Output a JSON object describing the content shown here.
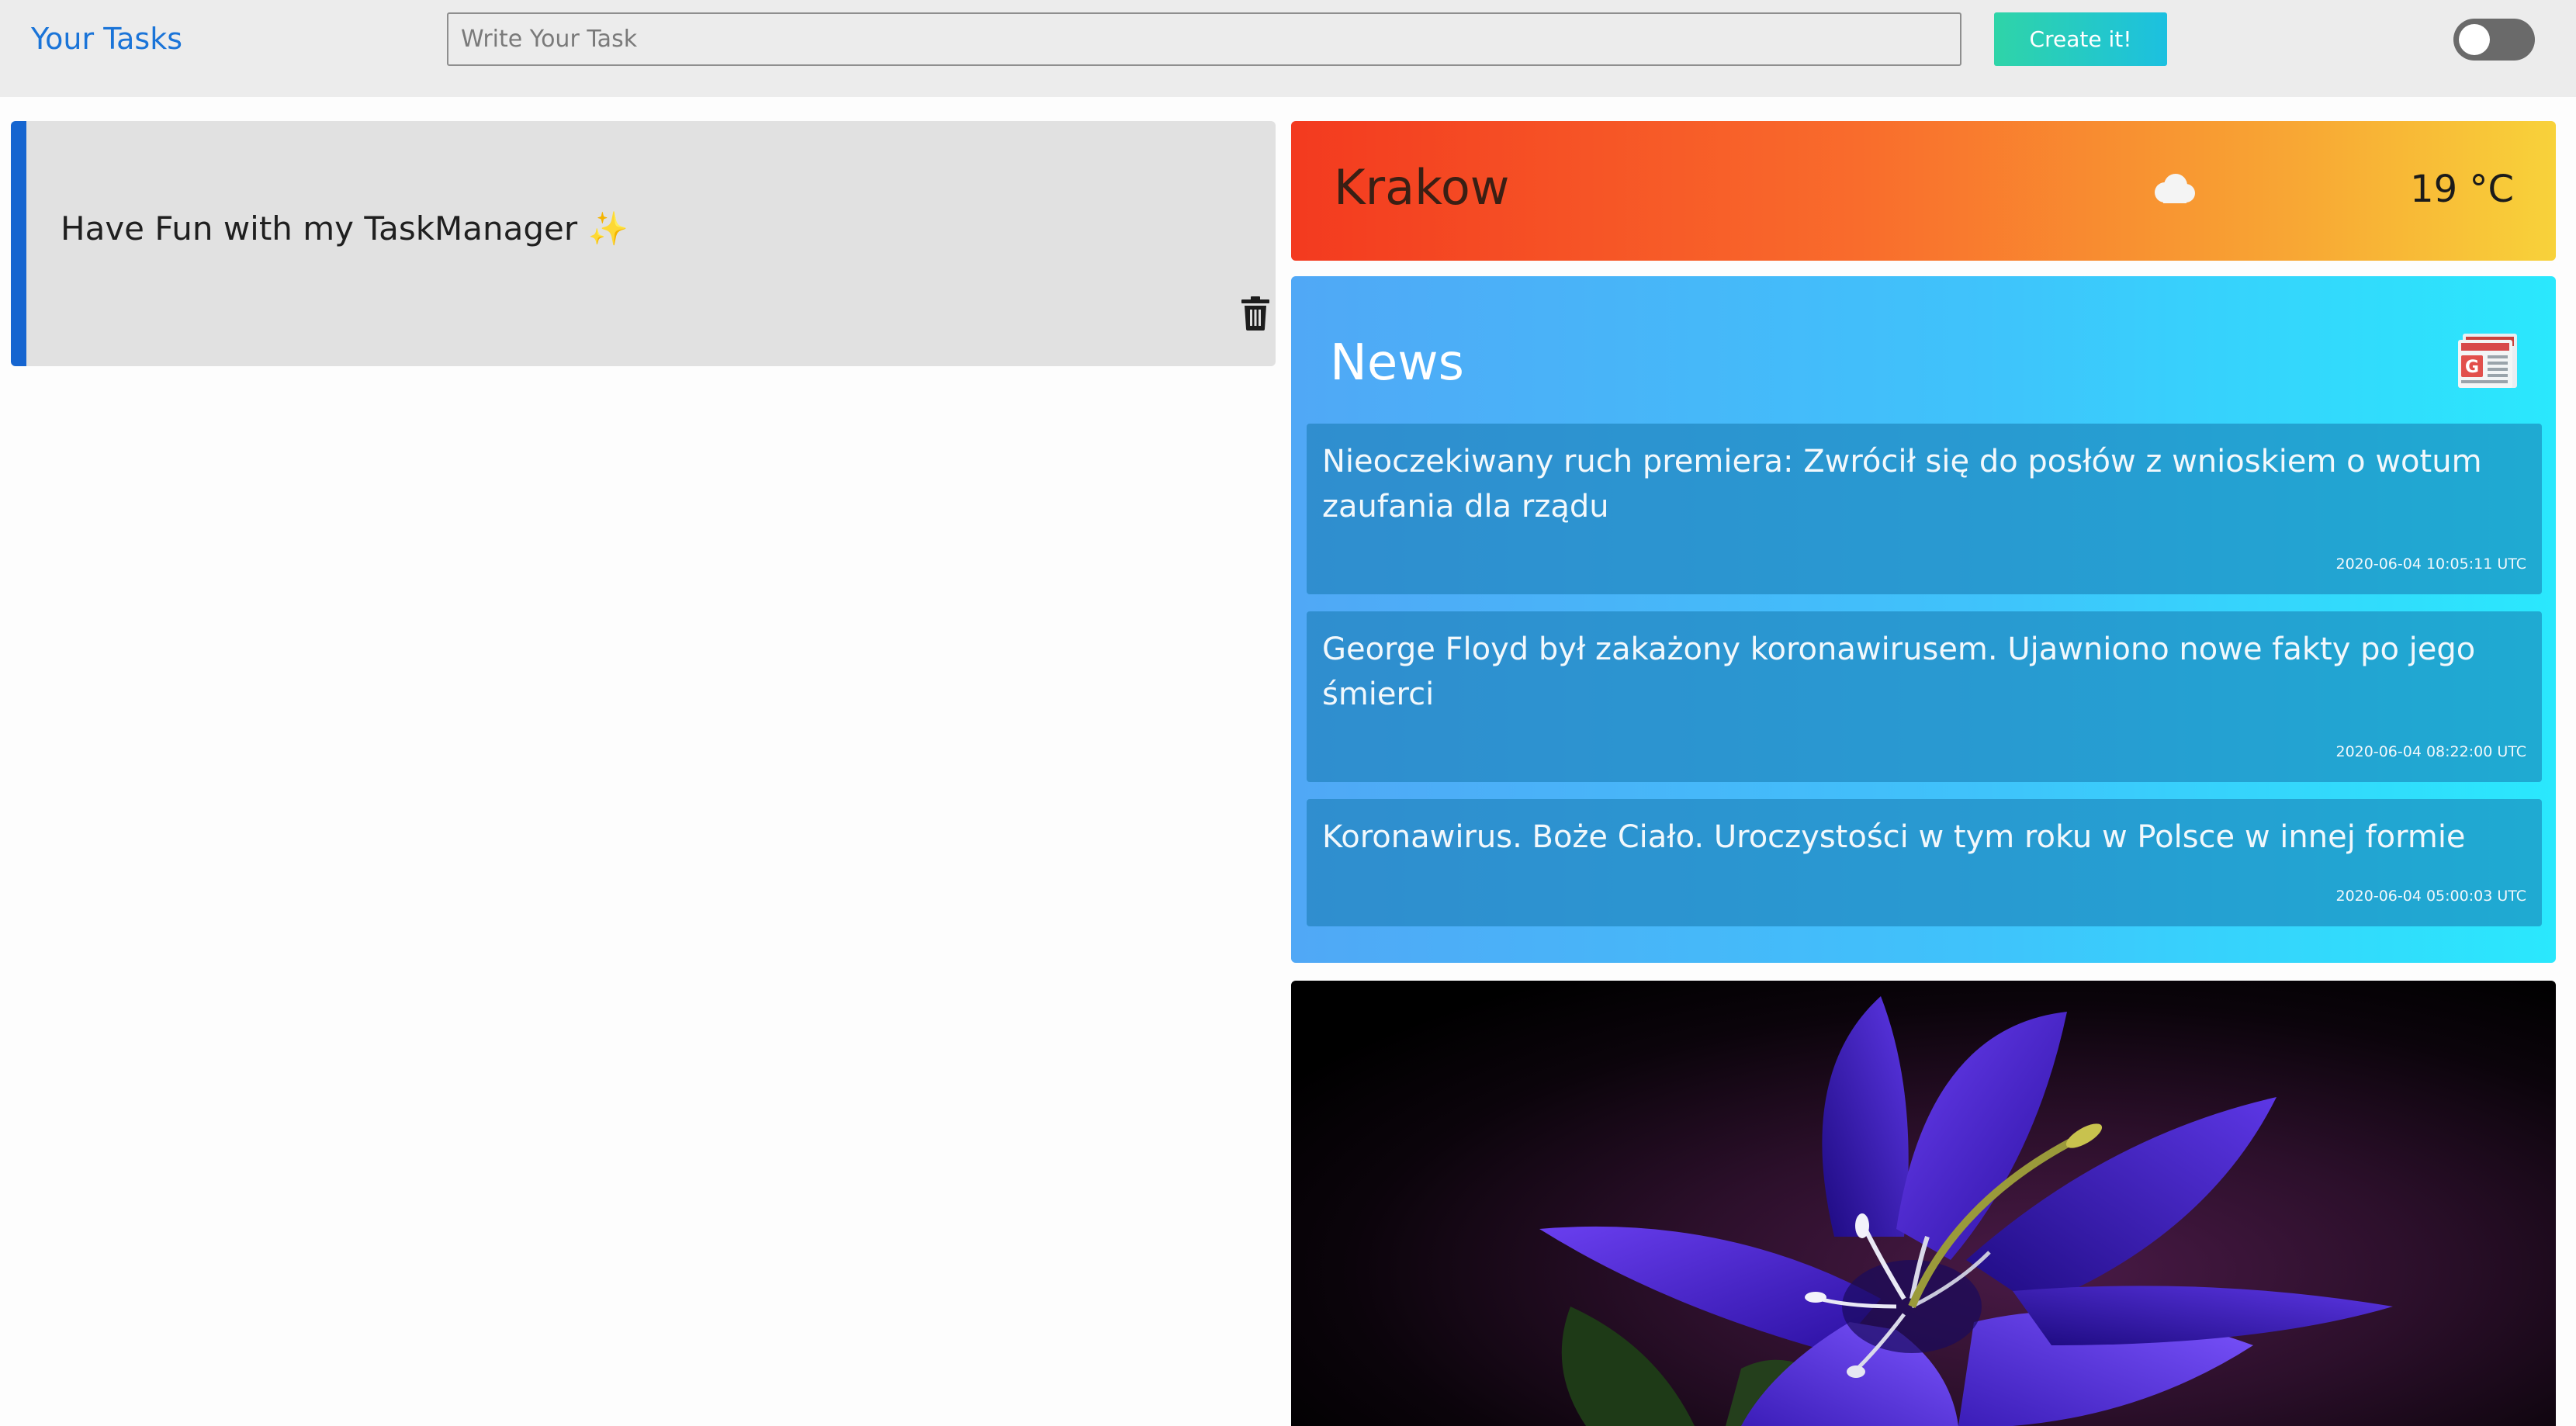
{
  "header": {
    "title": "Your Tasks",
    "task_placeholder": "Write Your Task",
    "create_label": "Create it!",
    "theme_toggle": {
      "state": "off"
    }
  },
  "tasks": [
    {
      "text": "Have Fun with my TaskManager",
      "emoji": "✨",
      "delete_icon": "trash-icon"
    }
  ],
  "weather": {
    "city": "Krakow",
    "icon": "cloud-icon",
    "temperature": "19 °C"
  },
  "news": {
    "title": "News",
    "icon": "google-news-icon",
    "items": [
      {
        "headline": "Nieoczekiwany ruch premiera: Zwrócił się do posłów z wnioskiem o wotum zaufania dla rządu",
        "time": "2020-06-04 10:05:11 UTC"
      },
      {
        "headline": "George Floyd był zakażony koronawirusem. Ujawniono nowe fakty po jego śmierci",
        "time": "2020-06-04 08:22:00 UTC"
      },
      {
        "headline": "Koronawirus. Boże Ciało. Uroczystości w tym roku w Polsce w innej formie",
        "time": "2020-06-04 05:00:03 UTC"
      }
    ]
  },
  "colors": {
    "accent_blue": "#1565d0",
    "create_button_start": "#2fd4a8",
    "create_button_end": "#1cc0e0",
    "weather_start": "#f33a1f",
    "weather_end": "#f8d23a",
    "news_start": "#50a8f6",
    "news_end": "#2ae8fd"
  }
}
